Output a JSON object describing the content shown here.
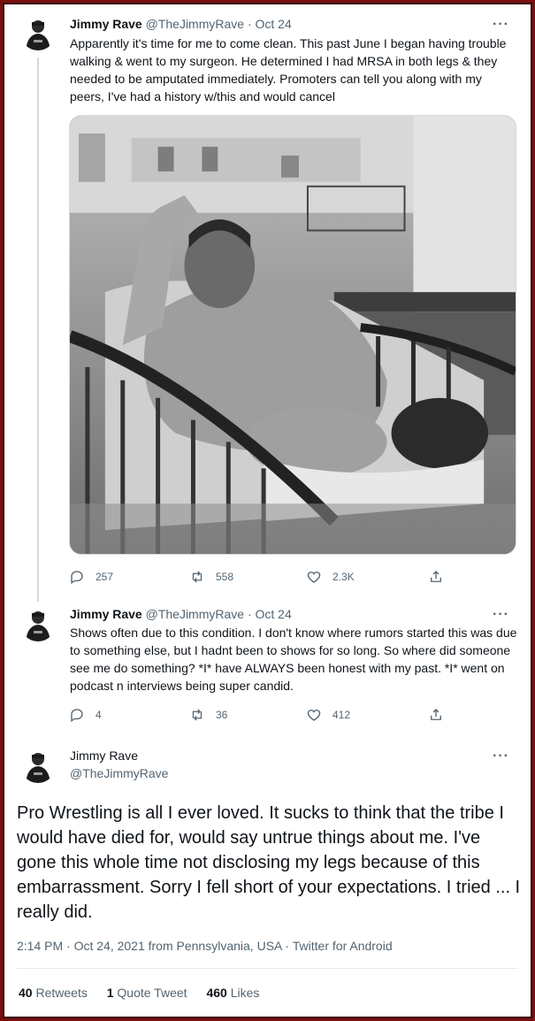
{
  "tweets": [
    {
      "name": "Jimmy Rave",
      "handle": "@TheJimmyRave",
      "dot": "·",
      "date": "Oct 24",
      "more": "···",
      "text": "Apparently it's time for me to come clean. This past June I began having trouble walking & went to my surgeon. He determined I had MRSA in both legs & they needed to be amputated immediately. Promoters can tell you along with my peers, I've had a history w/this and would cancel",
      "replies": "257",
      "retweets": "558",
      "likes": "2.3K"
    },
    {
      "name": "Jimmy Rave",
      "handle": "@TheJimmyRave",
      "dot": "·",
      "date": "Oct 24",
      "more": "···",
      "text": "Shows often due to this condition. I don't know where rumors started this was due to something else, but I hadnt  been to shows for so long. So where did someone see me do something? *I* have ALWAYS been honest with my past. *I* went on podcast n interviews being super candid.",
      "replies": "4",
      "retweets": "36",
      "likes": "412"
    }
  ],
  "main_tweet": {
    "name": "Jimmy Rave",
    "handle": "@TheJimmyRave",
    "more": "···",
    "text": "Pro Wrestling is all I ever loved. It sucks to think that the tribe I would have died for, would say untrue things about me. I've gone this whole time not disclosing my legs because of this embarrassment. Sorry I fell short of your expectations. I tried ... I really did.",
    "meta": "2:14 PM · Oct 24, 2021 from Pennsylvania, USA · Twitter for Android",
    "retweets_count": "40",
    "retweets_label": "Retweets",
    "quotes_count": "1",
    "quotes_label": "Quote Tweet",
    "likes_count": "460",
    "likes_label": "Likes"
  },
  "colors": {
    "frame": "#7a0f0f",
    "text": "#0f1419",
    "secondary": "#536471"
  },
  "icons": [
    "avatar",
    "more-icon",
    "reply-icon",
    "retweet-icon",
    "like-icon",
    "share-icon",
    "hospital-photo"
  ]
}
